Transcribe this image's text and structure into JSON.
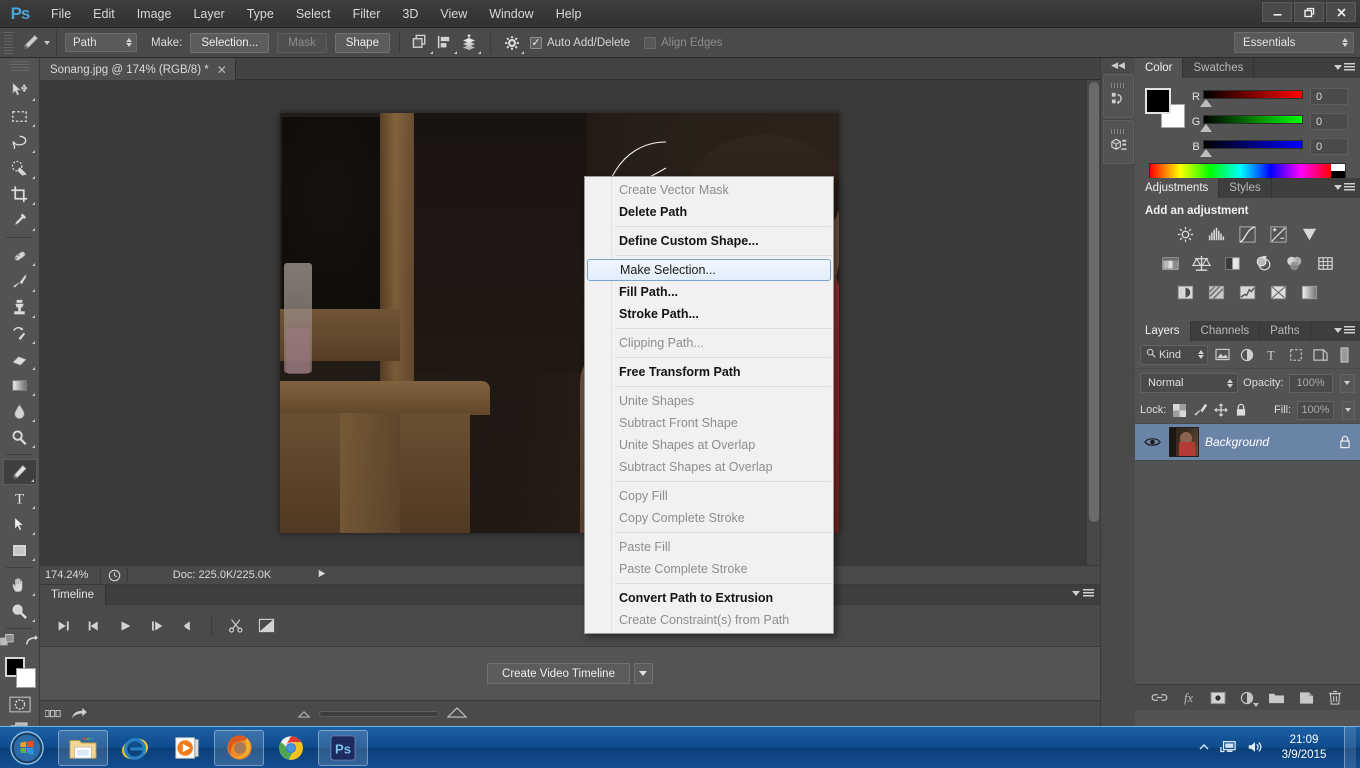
{
  "window": {
    "app_logo": "Ps",
    "controls": {
      "minimize": "—",
      "restore": "❐",
      "close": "✕"
    }
  },
  "menubar": {
    "items": [
      "File",
      "Edit",
      "Image",
      "Layer",
      "Type",
      "Select",
      "Filter",
      "3D",
      "View",
      "Window",
      "Help"
    ]
  },
  "options_bar": {
    "tool_icon": "pen-tool-icon",
    "mode_select": "Path",
    "make_label": "Make:",
    "selection_button": "Selection...",
    "mask_button": "Mask",
    "shape_button": "Shape",
    "path_operations_icon": "path-operations-icon",
    "path_alignment_icon": "path-alignment-icon",
    "path_arrangement_icon": "path-arrangement-icon",
    "gear_icon": "gear-icon",
    "auto_add_delete": {
      "label": "Auto Add/Delete",
      "checked": true
    },
    "align_edges": {
      "label": "Align Edges",
      "checked": false
    },
    "workspace": "Essentials"
  },
  "toolbox": {
    "tools": [
      {
        "name": "move-tool",
        "group": 1
      },
      {
        "name": "rectangular-marquee-tool",
        "group": 1
      },
      {
        "name": "lasso-tool",
        "group": 1
      },
      {
        "name": "quick-selection-tool",
        "group": 1
      },
      {
        "name": "crop-tool",
        "group": 1
      },
      {
        "name": "eyedropper-tool",
        "group": 1
      },
      {
        "name": "spot-healing-brush-tool",
        "group": 2
      },
      {
        "name": "brush-tool",
        "group": 2
      },
      {
        "name": "clone-stamp-tool",
        "group": 2
      },
      {
        "name": "history-brush-tool",
        "group": 2
      },
      {
        "name": "eraser-tool",
        "group": 2
      },
      {
        "name": "gradient-tool",
        "group": 2
      },
      {
        "name": "blur-tool",
        "group": 2
      },
      {
        "name": "dodge-tool",
        "group": 2
      },
      {
        "name": "pen-tool",
        "group": 3,
        "active": true
      },
      {
        "name": "horizontal-type-tool",
        "group": 3
      },
      {
        "name": "path-selection-tool",
        "group": 3
      },
      {
        "name": "rectangle-tool",
        "group": 3
      },
      {
        "name": "hand-tool",
        "group": 4
      },
      {
        "name": "zoom-tool",
        "group": 4
      }
    ],
    "edit_toolbar_icon": "edit-toolbar-icon",
    "swap_colors_icon": "swap-colors-icon",
    "foreground_color": "#000000",
    "background_color": "#ffffff",
    "quick_mask_icon": "quick-mask-icon",
    "screen_mode_icon": "screen-mode-icon"
  },
  "document": {
    "tab_title": "Sonang.jpg @ 174% (RGB/8) *",
    "close_label": "✕",
    "canvas_alt": "photo of a child covering face next to a wooden cabinet"
  },
  "status_bar": {
    "zoom": "174.24%",
    "timer_icon": "clock-icon",
    "doc_info": "Doc: 225.0K/225.0K",
    "expand_icon": "play-arrow-icon"
  },
  "timeline": {
    "tab_label": "Timeline",
    "panel_menu_icon": "panel-menu-icon",
    "controls": [
      "go-to-first-frame-icon",
      "previous-frame-icon",
      "play-icon",
      "next-frame-icon",
      "audio-icon",
      "split-at-playhead-icon",
      "transition-icon"
    ],
    "create_button": "Create Video Timeline",
    "create_caret": "▼"
  },
  "bottom_strip": {
    "grid_icon": "grid-icon",
    "share_icon": "share-arrow-icon",
    "zoom_out_icon": "small-mountain-icon",
    "zoom_in_icon": "large-mountain-icon"
  },
  "rail": {
    "collapse_icon": "collapse-panels-icon",
    "buttons": [
      "history-panel-icon",
      "3d-panel-icon"
    ]
  },
  "color_panel": {
    "tabs": [
      {
        "label": "Color",
        "active": true
      },
      {
        "label": "Swatches",
        "active": false
      }
    ],
    "foreground": "#000000",
    "background": "#ffffff",
    "channels": [
      {
        "label": "R",
        "value": "0"
      },
      {
        "label": "G",
        "value": "0"
      },
      {
        "label": "B",
        "value": "0"
      }
    ]
  },
  "adjustments_panel": {
    "tabs": [
      {
        "label": "Adjustments",
        "active": true
      },
      {
        "label": "Styles",
        "active": false
      }
    ],
    "title": "Add an adjustment",
    "rows": [
      [
        "brightness-contrast-icon",
        "levels-icon",
        "curves-icon",
        "exposure-icon",
        "vibrance-icon"
      ],
      [
        "hue-saturation-icon",
        "color-balance-icon",
        "black-white-icon",
        "photo-filter-icon",
        "channel-mixer-icon",
        "color-lookup-icon"
      ],
      [
        "invert-icon",
        "posterize-icon",
        "threshold-icon",
        "gradient-map-icon",
        "selective-color-icon"
      ]
    ]
  },
  "layers_panel": {
    "tabs": [
      {
        "label": "Layers",
        "active": true
      },
      {
        "label": "Channels",
        "active": false
      },
      {
        "label": "Paths",
        "active": false
      }
    ],
    "filter": {
      "kind_label": "Kind",
      "search_icon": "search-icon",
      "filter_icons": [
        "filter-image-icon",
        "filter-adjustment-icon",
        "filter-type-icon",
        "filter-shape-icon",
        "filter-smart-object-icon"
      ],
      "toggle_icon": "filter-toggle-icon"
    },
    "blend_mode": "Normal",
    "opacity_label": "Opacity:",
    "opacity_value": "100%",
    "lock_label": "Lock:",
    "lock_icons": [
      "lock-transparent-pixels-icon",
      "lock-image-pixels-icon",
      "lock-position-icon",
      "lock-all-icon"
    ],
    "fill_label": "Fill:",
    "fill_value": "100%",
    "layers": [
      {
        "name": "Background",
        "visible": true,
        "locked": true,
        "selected": true
      }
    ],
    "footer_icons": [
      "link-layers-icon",
      "layer-style-icon",
      "layer-mask-icon",
      "new-fill-adjustment-icon",
      "new-group-icon",
      "new-layer-icon",
      "delete-layer-icon"
    ]
  },
  "context_menu": {
    "items": [
      {
        "label": "Create Vector Mask",
        "state": "disabled"
      },
      {
        "label": "Delete Path",
        "state": "bold"
      },
      {
        "separator": true
      },
      {
        "label": "Define Custom Shape...",
        "state": "bold"
      },
      {
        "separator": true
      },
      {
        "label": "Make Selection...",
        "state": "highlight"
      },
      {
        "label": "Fill Path...",
        "state": "bold"
      },
      {
        "label": "Stroke Path...",
        "state": "bold"
      },
      {
        "separator": true
      },
      {
        "label": "Clipping Path...",
        "state": "disabled"
      },
      {
        "separator": true
      },
      {
        "label": "Free Transform Path",
        "state": "bold"
      },
      {
        "separator": true
      },
      {
        "label": "Unite Shapes",
        "state": "disabled"
      },
      {
        "label": "Subtract Front Shape",
        "state": "disabled"
      },
      {
        "label": "Unite Shapes at Overlap",
        "state": "disabled"
      },
      {
        "label": "Subtract Shapes at Overlap",
        "state": "disabled"
      },
      {
        "separator": true
      },
      {
        "label": "Copy Fill",
        "state": "disabled"
      },
      {
        "label": "Copy Complete Stroke",
        "state": "disabled"
      },
      {
        "separator": true
      },
      {
        "label": "Paste Fill",
        "state": "disabled"
      },
      {
        "label": "Paste Complete Stroke",
        "state": "disabled"
      },
      {
        "separator": true
      },
      {
        "label": "Convert Path to Extrusion",
        "state": "bold"
      },
      {
        "label": "Create Constraint(s) from Path",
        "state": "disabled"
      }
    ]
  },
  "taskbar": {
    "start_icon": "windows-start-orb-icon",
    "items": [
      {
        "name": "windows-explorer-icon",
        "pinned": true
      },
      {
        "name": "internet-explorer-icon",
        "pinned": false
      },
      {
        "name": "windows-media-player-icon",
        "pinned": false
      },
      {
        "name": "firefox-icon",
        "pinned": true
      },
      {
        "name": "google-chrome-icon",
        "pinned": false
      },
      {
        "name": "photoshop-icon",
        "pinned": true
      }
    ],
    "tray": {
      "show_hidden_icon": "show-hidden-icons-icon",
      "network_icon": "network-icon",
      "volume_icon": "volume-icon",
      "time": "21:09",
      "date": "3/9/2015"
    }
  },
  "colors": {
    "chrome": "#535353",
    "panel": "#4a4a4a",
    "dark": "#3a3a3a",
    "accent": "#6a84a8",
    "menu_highlight": "#e2eefb",
    "taskbar": "#0e4b8c"
  }
}
